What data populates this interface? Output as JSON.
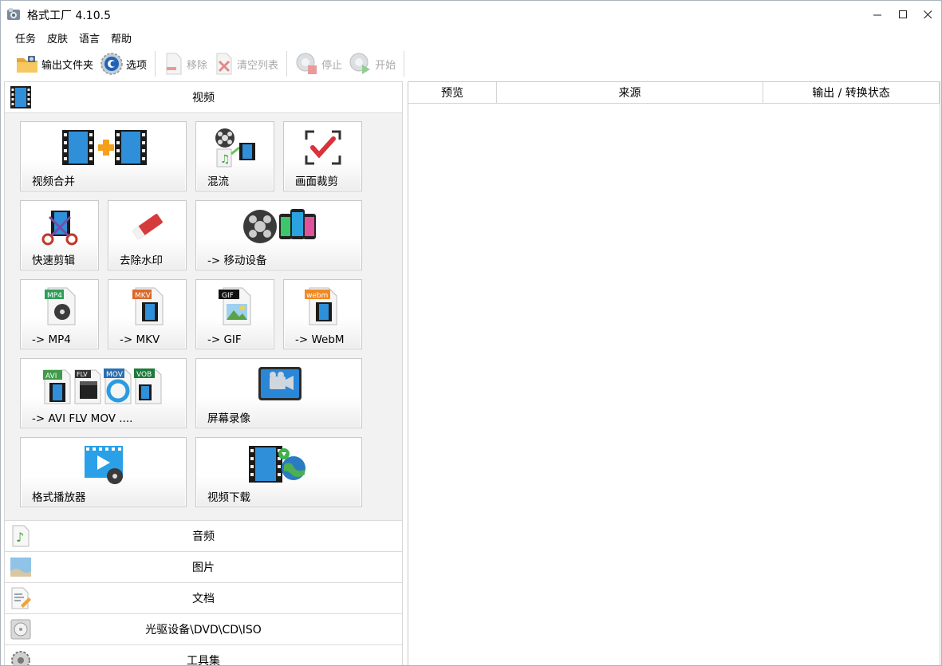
{
  "window": {
    "title": "格式工厂 4.10.5",
    "minimize": "—",
    "maximize": "☐",
    "close": "✕"
  },
  "menu": [
    "任务",
    "皮肤",
    "语言",
    "帮助"
  ],
  "toolbar": {
    "output_folder": "输出文件夹",
    "options": "选项",
    "remove": "移除",
    "clear_list": "清空列表",
    "stop": "停止",
    "start": "开始"
  },
  "categories": {
    "video": "视频",
    "audio": "音频",
    "image": "图片",
    "document": "文档",
    "rom": "光驱设备\\DVD\\CD\\ISO",
    "tools": "工具集"
  },
  "tiles": {
    "video_merge": "视频合并",
    "mux": "混流",
    "crop": "画面裁剪",
    "quick_clip": "快速剪辑",
    "remove_watermark": "去除水印",
    "mobile": "-> 移动设备",
    "mp4": "-> MP4",
    "mkv": "-> MKV",
    "gif": "-> GIF",
    "webm": "-> WebM",
    "avi_flv_mov": "-> AVI FLV MOV ....",
    "screen_record": "屏幕录像",
    "player": "格式播放器",
    "download": "视频下载"
  },
  "icon_badges": {
    "mp4": "MP4",
    "mkv": "MKV",
    "gif": "GIF",
    "webm": "webm",
    "avi": "AVI",
    "flv": "FLV",
    "mov": "MOV",
    "vob": "VOB"
  },
  "task_list": {
    "columns": [
      "预览",
      "来源",
      "输出 / 转换状态"
    ]
  },
  "colors": {
    "film_blue": "#2f8fd8",
    "accent_orange": "#f5a01a",
    "check_red": "#d9323a",
    "disabled_text": "#a8a8a8"
  }
}
